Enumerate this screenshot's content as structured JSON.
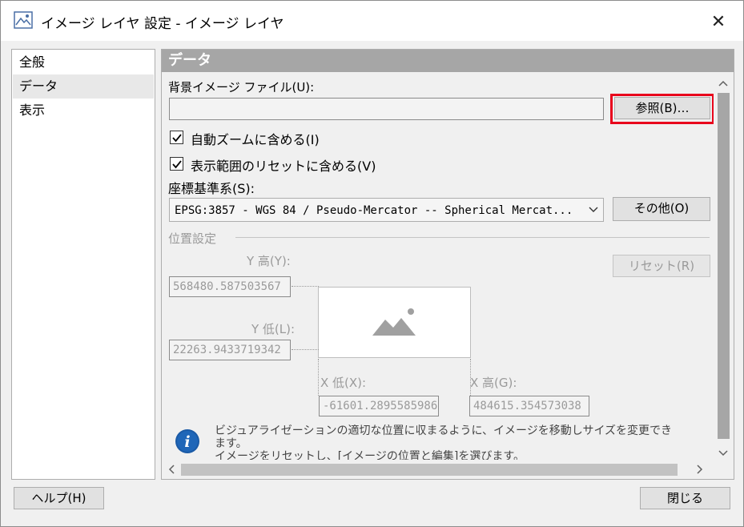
{
  "window": {
    "title": "イメージ レイヤ 設定 - イメージ レイヤ",
    "app_icon": "image-layer-icon",
    "close_glyph": "✕"
  },
  "nav": {
    "items": [
      {
        "label": "全般",
        "selected": false
      },
      {
        "label": "データ",
        "selected": true
      },
      {
        "label": "表示",
        "selected": false
      }
    ]
  },
  "data_section": {
    "header": "データ",
    "bg_image_label": "背景イメージ ファイル(U):",
    "bg_image_value": "",
    "browse_button": "参照(B)…",
    "auto_zoom_label": "自動ズームに含める(I)",
    "auto_zoom_checked": true,
    "reset_extent_label": "表示範囲のリセットに含める(V)",
    "reset_extent_checked": true,
    "crs_label": "座標基準系(S):",
    "crs_value": "EPSG:3857 - WGS 84 / Pseudo-Mercator -- Spherical Mercat...",
    "crs_other_button": "その他(O)",
    "position_group": "位置設定",
    "y_high_label": "Y 高(Y):",
    "y_high_value": "568480.587503567",
    "y_low_label": "Y 低(L):",
    "y_low_value": "22263.9433719342",
    "x_low_label": "X 低(X):",
    "x_low_value": "-61601.2895585986",
    "x_high_label": "X 高(G):",
    "x_high_value": "484615.354573038",
    "reset_button": "リセット(R)",
    "info_line1": "ビジュアライゼーションの適切な位置に収まるように、イメージを移動しサイズを変更でき",
    "info_line2": "ます。",
    "info_line3": "イメージをリセットし、[イメージの位置と編集]を選びます。"
  },
  "footer": {
    "help_button": "ヘルプ(H)",
    "close_button": "閉じる"
  },
  "colors": {
    "highlight": "#e8001c",
    "section_header": "#a6a6a6",
    "info_icon": "#1a5aa6"
  }
}
